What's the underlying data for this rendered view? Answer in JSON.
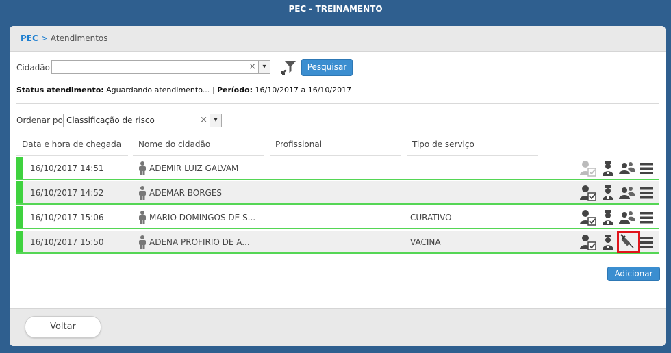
{
  "window": {
    "title": "PEC - TREINAMENTO"
  },
  "breadcrumb": {
    "root": "PEC",
    "separator": ">",
    "current": "Atendimentos"
  },
  "filter": {
    "cidadao_label": "Cidadão",
    "cidadao_value": "",
    "clear_symbol": "×",
    "dropdown_symbol": "▾",
    "filter_icon": "funnel-icon",
    "search_button": "Pesquisar"
  },
  "status": {
    "status_label": "Status atendimento:",
    "status_value": "Aguardando atendimento...",
    "divider": "|",
    "periodo_label": "Período:",
    "periodo_value": "16/10/2017 a 16/10/2017"
  },
  "sort": {
    "label": "Ordenar por",
    "value": "Classificação de risco"
  },
  "table": {
    "headers": [
      "Data e hora de chegada",
      "Nome do cidadão",
      "Profissional",
      "Tipo de serviço"
    ],
    "rows": [
      {
        "datetime": "16/10/2017 14:51",
        "name": "ADEMIR LUIZ GALVAM",
        "profissional": "",
        "servico": ""
      },
      {
        "datetime": "16/10/2017 14:52",
        "name": "ADEMAR BORGES",
        "profissional": "",
        "servico": ""
      },
      {
        "datetime": "16/10/2017 15:06",
        "name": "MARIO DOMINGOS DE S...",
        "profissional": "",
        "servico": "CURATIVO"
      },
      {
        "datetime": "16/10/2017 15:50",
        "name": "ADENA PROFIRIO DE A...",
        "profissional": "",
        "servico": "VACINA"
      }
    ],
    "action_icons": [
      "attend-icon",
      "nurse-icon",
      "group-icon",
      "menu-icon"
    ],
    "vaccine_icon": "syringe-icon"
  },
  "buttons": {
    "add": "Adicionar",
    "back": "Voltar"
  },
  "colors": {
    "accent": "#3b8ed0",
    "risk_green": "#3fd23f",
    "highlight": "#e0141b",
    "background": "#2f5f8f"
  }
}
